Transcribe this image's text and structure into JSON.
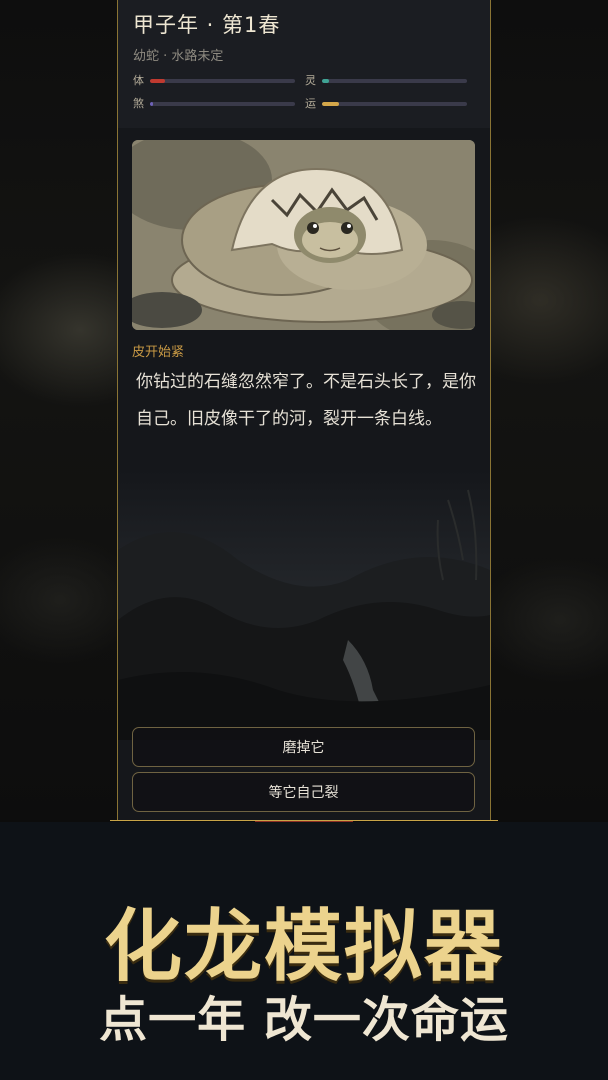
{
  "header": {
    "title": "甲子年 · 第1春",
    "subtitle": "幼蛇 · 水路未定"
  },
  "stats": [
    {
      "label": "体",
      "value": 0.1,
      "color": "#c03a30"
    },
    {
      "label": "灵",
      "value": 0.05,
      "color": "#3fa394"
    },
    {
      "label": "煞",
      "value": 0.02,
      "color": "#6e62b8"
    },
    {
      "label": "运",
      "value": 0.12,
      "color": "#d4a74a"
    }
  ],
  "event": {
    "image_icon": "snake-hatching-from-egg-image",
    "title": "皮开始紧",
    "text": "你钻过的石缝忽然窄了。不是石头长了，是你自己。旧皮像干了的河，裂开一条白线。"
  },
  "choices": [
    {
      "label": "磨掉它"
    },
    {
      "label": "等它自己裂"
    }
  ],
  "promo": {
    "title": "化龙模拟器",
    "subtitle": "点一年 改一次命运"
  },
  "colors": {
    "gold": "#c9a548",
    "event_title": "#c99a45",
    "panel": "#15171b",
    "header": "#1b1d22"
  }
}
